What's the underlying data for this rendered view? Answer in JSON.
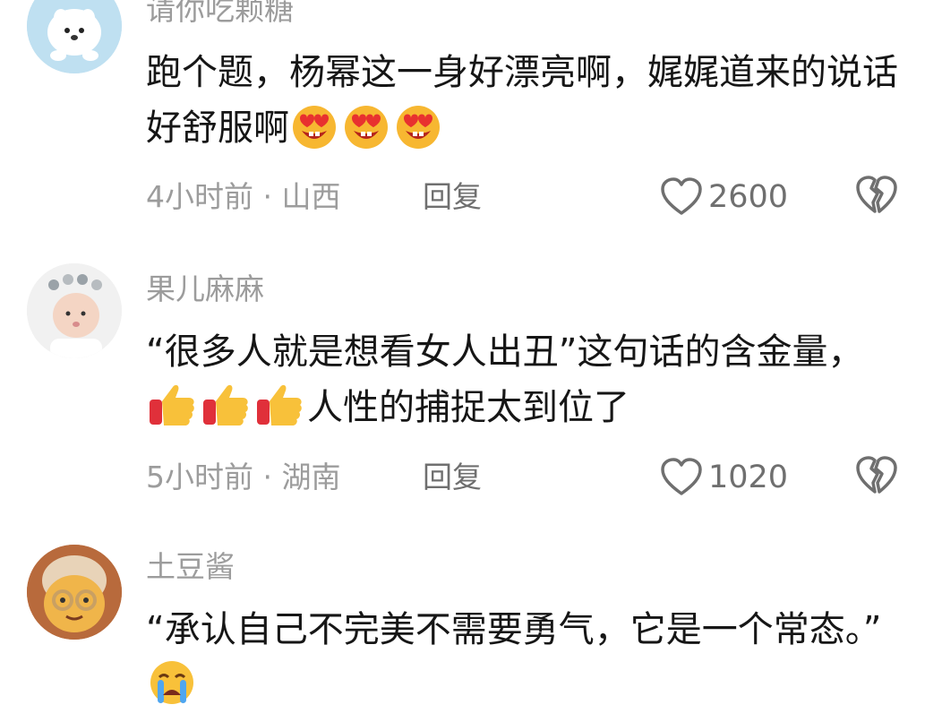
{
  "comments": [
    {
      "username": "请你吃颗糖",
      "text_before": "跑个题，杨幂这一身好漂亮啊，娓娓道来的说话好舒服啊",
      "text_after": "",
      "emojis": [
        "heart-eyes-emoji",
        "heart-eyes-emoji",
        "heart-eyes-emoji"
      ],
      "time": "4小时前",
      "separator": "·",
      "location": "山西",
      "reply_label": "回复",
      "like_count": "2600"
    },
    {
      "username": "果儿麻麻",
      "text_before": "“很多人就是想看女人出丑”这句话的含金量，",
      "text_after": "人性的捕捉太到位了",
      "emojis": [
        "thumbs-up-emoji",
        "thumbs-up-emoji",
        "thumbs-up-emoji"
      ],
      "time": "5小时前",
      "separator": "·",
      "location": "湖南",
      "reply_label": "回复",
      "like_count": "1020"
    },
    {
      "username": "土豆酱",
      "text_before": "“承认自己不完美不需要勇气，它是一个常态。”",
      "text_after": "",
      "emojis": [
        "crying-face-emoji"
      ]
    }
  ],
  "colors": {
    "username": "#9c9c9c",
    "body_text": "#161616",
    "meta": "#9c9c9c",
    "action": "#6f6f6f"
  }
}
